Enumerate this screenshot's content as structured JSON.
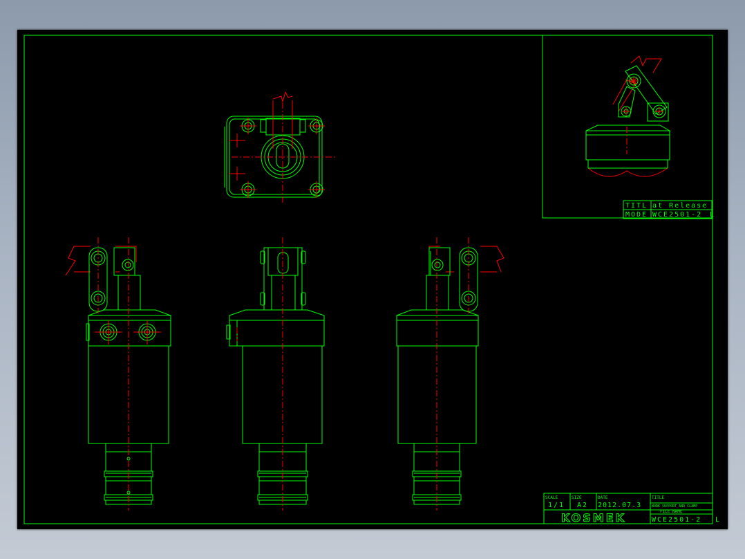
{
  "title_box": {
    "title_label": "TITL",
    "title_value": "at Release",
    "model_label": "MODE",
    "model_value": "WCE2501-2",
    "model_suffix": "L"
  },
  "title_block": {
    "scale_label": "SCALE",
    "scale_value": "1/1",
    "size_label": "SIZE",
    "size_value": "A2",
    "date_label": "DATE",
    "date_value": "2012.07.3",
    "title_label": "TITLE",
    "title_value": "WORK SUPPORT AND CLAMP",
    "file_label": "FILE NAME",
    "file_value": "WCE2501-2",
    "file_suffix": "L",
    "company_logo": "KOSMEK"
  },
  "colors": {
    "background": "#000000",
    "outline": "#00ff00",
    "centerline": "#ff0000"
  }
}
